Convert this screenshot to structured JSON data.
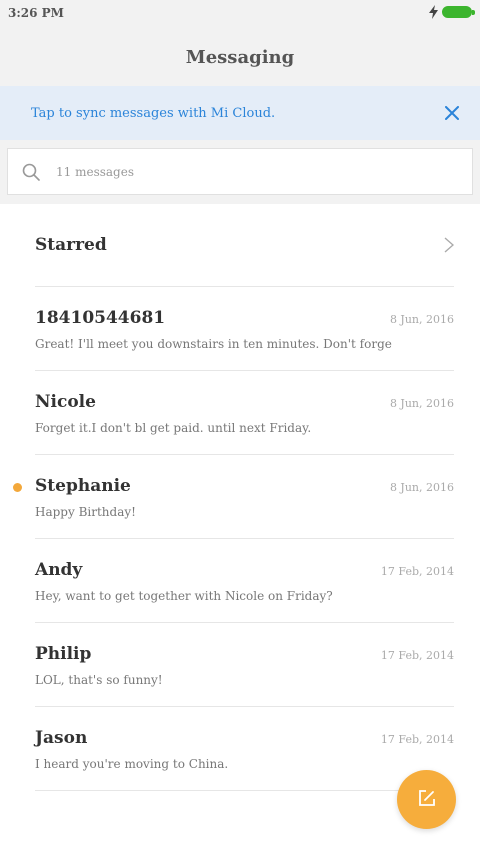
{
  "status_bar": {
    "time": "3:26 PM"
  },
  "header": {
    "title": "Messaging"
  },
  "sync_banner": {
    "text": "Tap to sync messages with Mi Cloud."
  },
  "search": {
    "placeholder": "11 messages"
  },
  "starred": {
    "label": "Starred"
  },
  "conversations": [
    {
      "name": "18410544681",
      "date": "8 Jun, 2016",
      "preview": "Great! I'll meet you downstairs in ten minutes. Don't forge",
      "unread": false
    },
    {
      "name": "Nicole",
      "date": "8 Jun, 2016",
      "preview": "Forget it.I don't bl get paid. until next Friday.",
      "unread": false
    },
    {
      "name": "Stephanie",
      "date": "8 Jun, 2016",
      "preview": "Happy Birthday!",
      "unread": true
    },
    {
      "name": "Andy",
      "date": "17 Feb, 2014",
      "preview": "Hey, want to get together with Nicole on Friday?",
      "unread": false
    },
    {
      "name": "Philip",
      "date": "17 Feb, 2014",
      "preview": "LOL, that's so funny!",
      "unread": false
    },
    {
      "name": "Jason",
      "date": "17 Feb, 2014",
      "preview": "I heard you're moving to China.",
      "unread": false
    }
  ],
  "icons": {
    "status": [
      "bolt-icon",
      "battery-icon"
    ],
    "banner": "close-icon",
    "search": "search-icon",
    "starred": "chevron-right-icon",
    "fab": "compose-icon"
  },
  "colors": {
    "accent": "#f6ad3c",
    "link": "#2b84d9",
    "banner_bg": "#e4edf8",
    "battery": "#3cb52e",
    "unread_dot": "#f3a83b"
  }
}
